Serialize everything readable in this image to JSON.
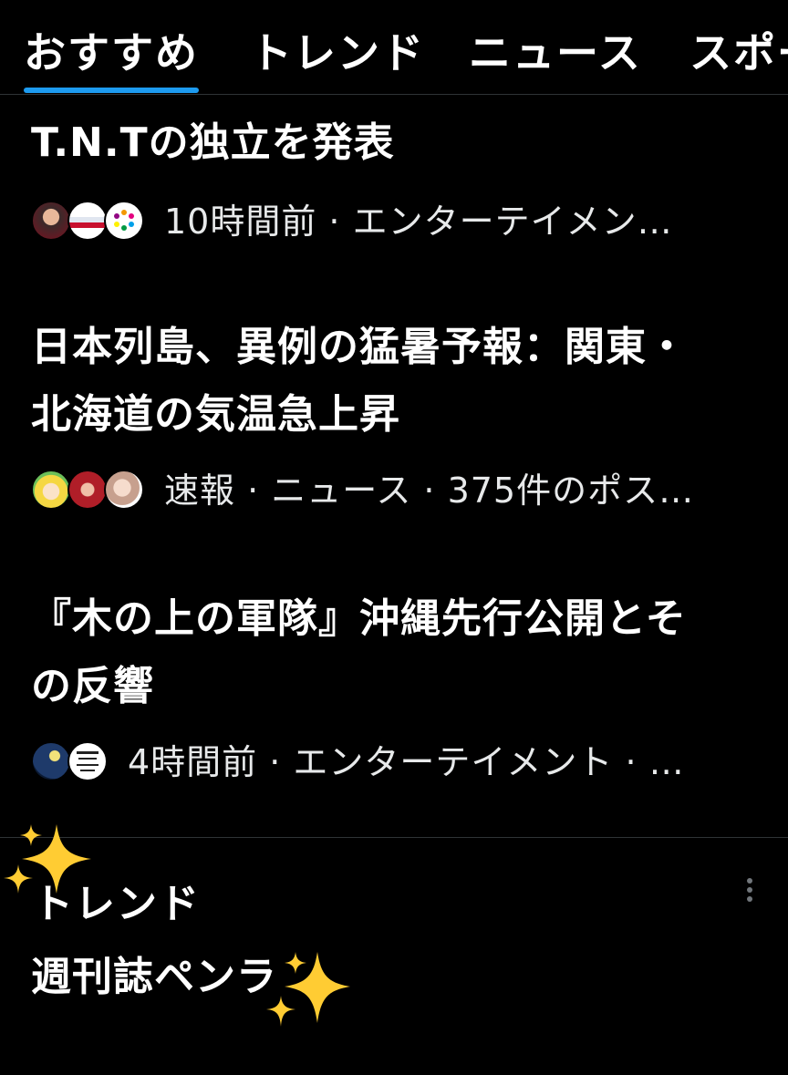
{
  "tabs": [
    {
      "label": "おすすめ",
      "selected": true
    },
    {
      "label": "トレンド",
      "selected": false
    },
    {
      "label": "ニュース",
      "selected": false
    },
    {
      "label": "スポーツ",
      "selected": false
    }
  ],
  "accent_color": "#1d9bf0",
  "stories": [
    {
      "title": "T.N.Tの独立を発表",
      "meta": "10時間前 · エンターテイメン…"
    },
    {
      "title": "日本列島、異例の猛暑予報：関東・\n北海道の気温急上昇",
      "meta": "速報 · ニュース · 375件のポス…"
    },
    {
      "title": "『木の上の軍隊』沖縄先行公開とそ\nの反響",
      "meta": "4時間前 · エンターテイメント · …"
    }
  ],
  "trend": {
    "label": "トレンド",
    "name": "週刊誌ペンラ"
  },
  "icons": {
    "more": "more-vertical-icon",
    "sparkles": "sparkles-emoji"
  }
}
